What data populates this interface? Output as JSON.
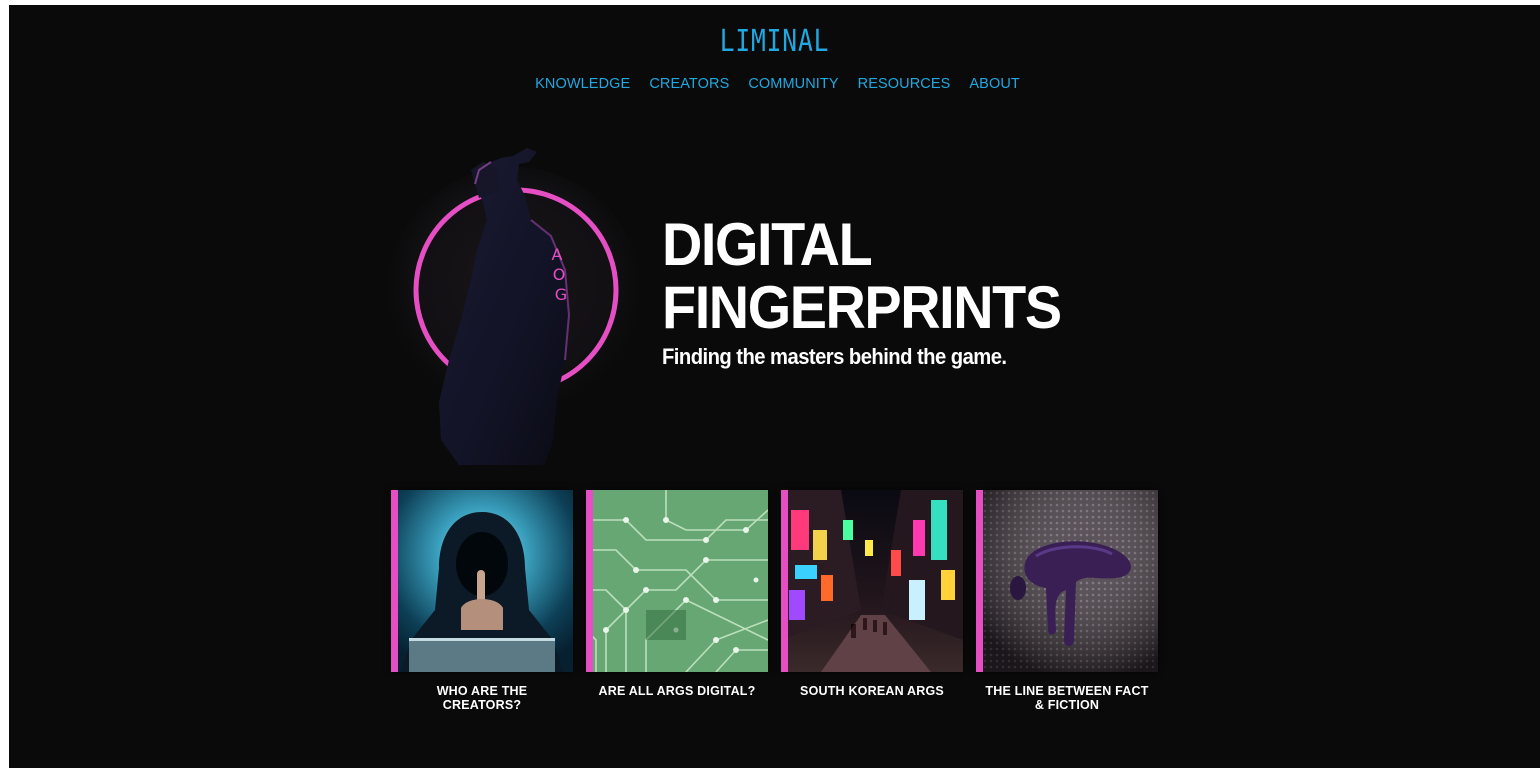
{
  "header": {
    "logo_text": "LIMINAL",
    "nav": [
      {
        "label": "KNOWLEDGE"
      },
      {
        "label": "CREATORS"
      },
      {
        "label": "COMMUNITY"
      },
      {
        "label": "RESOURCES"
      },
      {
        "label": "ABOUT"
      }
    ]
  },
  "hero": {
    "title_line1": "DIGITAL",
    "title_line2": "FINGERPRINTS",
    "subtitle": "Finding the masters behind the game.",
    "figure_sleeve_text": "AOG"
  },
  "cards": [
    {
      "label": "WHO ARE THE CREATORS?"
    },
    {
      "label": "ARE ALL ARGS DIGITAL?"
    },
    {
      "label": "SOUTH KOREAN ARGS"
    },
    {
      "label": "THE LINE BETWEEN FACT & FICTION"
    }
  ],
  "colors": {
    "background": "#0a0a0a",
    "accent_blue": "#21a8e0",
    "accent_pink": "#e64fc4",
    "text": "#ffffff"
  }
}
